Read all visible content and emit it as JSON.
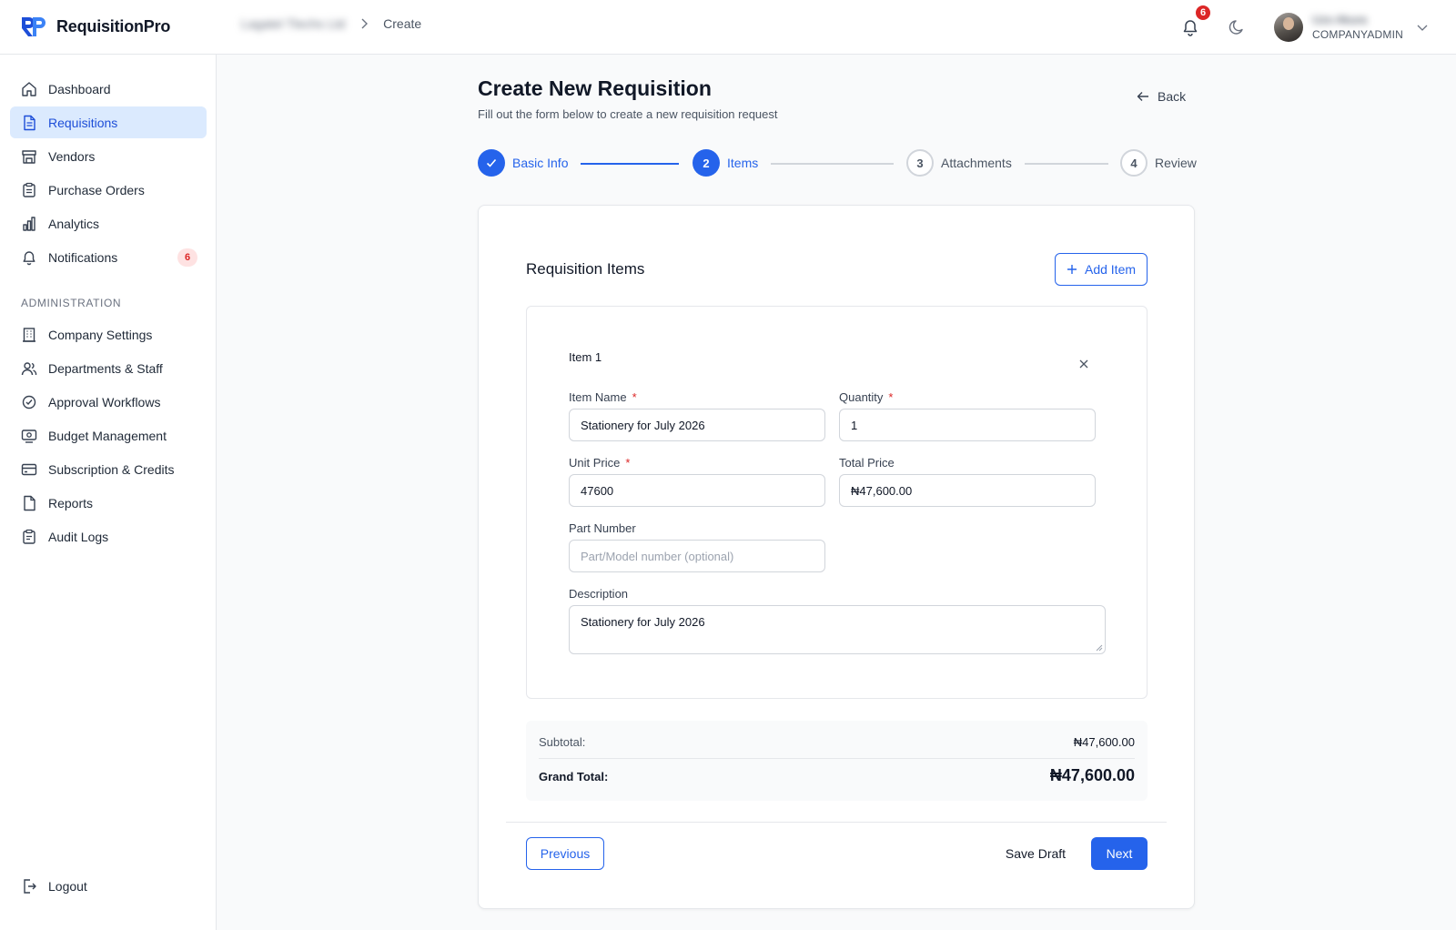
{
  "app": {
    "name": "RequisitionPro",
    "brand_color": "#2563eb"
  },
  "header": {
    "breadcrumb": {
      "parent": "Lagatel Tlechs Ltd",
      "current": "Create"
    },
    "notification_count": "6",
    "user": {
      "name": "Uzo Akura",
      "role": "COMPANYADMIN"
    }
  },
  "sidebar": {
    "items": [
      {
        "label": "Dashboard",
        "icon": "home-icon"
      },
      {
        "label": "Requisitions",
        "icon": "document-icon",
        "active": true
      },
      {
        "label": "Vendors",
        "icon": "store-icon"
      },
      {
        "label": "Purchase Orders",
        "icon": "clipboard-icon"
      },
      {
        "label": "Analytics",
        "icon": "bar-chart-icon"
      },
      {
        "label": "Notifications",
        "icon": "bell-icon",
        "badge": "6"
      }
    ],
    "admin_section": "ADMINISTRATION",
    "admin_items": [
      {
        "label": "Company Settings",
        "icon": "building-icon"
      },
      {
        "label": "Departments & Staff",
        "icon": "users-icon"
      },
      {
        "label": "Approval Workflows",
        "icon": "workflow-icon"
      },
      {
        "label": "Budget Management",
        "icon": "budget-icon"
      },
      {
        "label": "Subscription & Credits",
        "icon": "credit-card-icon"
      },
      {
        "label": "Reports",
        "icon": "report-icon"
      },
      {
        "label": "Audit Logs",
        "icon": "audit-log-icon"
      }
    ],
    "logout": "Logout"
  },
  "page": {
    "title": "Create New Requisition",
    "subtitle": "Fill out the form below to create a new requisition request",
    "back": "Back"
  },
  "stepper": {
    "steps": [
      {
        "label": "Basic Info",
        "number": "1",
        "state": "done"
      },
      {
        "label": "Items",
        "number": "2",
        "state": "current"
      },
      {
        "label": "Attachments",
        "number": "3",
        "state": "pending"
      },
      {
        "label": "Review",
        "number": "4",
        "state": "pending"
      }
    ]
  },
  "items_card": {
    "title": "Requisition Items",
    "add_item": "Add Item",
    "item": {
      "title": "Item 1",
      "item_name_label": "Item Name",
      "item_name_value": "Stationery for July 2026",
      "quantity_label": "Quantity",
      "quantity_value": "1",
      "unit_price_label": "Unit Price",
      "unit_price_value": "47600",
      "total_price_label": "Total Price",
      "total_price_value": "₦47,600.00",
      "part_number_label": "Part Number",
      "part_number_placeholder": "Part/Model number (optional)",
      "description_label": "Description",
      "description_value": "Stationery for July 2026"
    },
    "totals": {
      "subtotal_label": "Subtotal:",
      "subtotal_value": "₦47,600.00",
      "grand_total_label": "Grand Total:",
      "grand_total_value": "₦47,600.00"
    },
    "actions": {
      "previous": "Previous",
      "save_draft": "Save Draft",
      "next": "Next"
    }
  }
}
